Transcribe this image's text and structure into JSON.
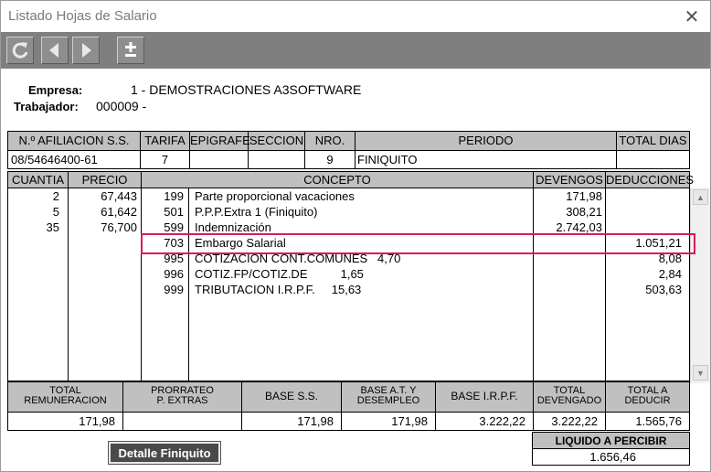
{
  "window": {
    "title": "Listado Hojas de Salario",
    "close_glyph": "✕"
  },
  "toolbar": {
    "buttons": [
      {
        "name": "refresh-icon"
      },
      {
        "name": "prev-icon"
      },
      {
        "name": "next-icon"
      },
      {
        "name": "plus-minus-icon"
      }
    ]
  },
  "header": {
    "empresa_label": "Empresa:",
    "empresa_value": "1 - DEMOSTRACIONES A3SOFTWARE",
    "trabajador_label": "Trabajador:",
    "trabajador_value": "000009 -"
  },
  "info_table": {
    "headers": [
      "N.º AFILIACION S.S.",
      "TARIFA",
      "EPIGRAFE",
      "SECCION",
      "NRO.",
      "PERIODO",
      "TOTAL DIAS"
    ],
    "values": [
      "08/54646400-61",
      "7",
      "",
      "",
      "9",
      "FINIQUITO",
      ""
    ]
  },
  "concept_table": {
    "headers": [
      "CUANTIA",
      "PRECIO",
      "CONCEPTO",
      "DEVENGOS",
      "DEDUCCIONES"
    ],
    "rows": [
      {
        "cuantia": "2",
        "precio": "67,443",
        "code": "199",
        "concepto": "Parte proporcional vacaciones",
        "devengos": "171,98",
        "deducciones": ""
      },
      {
        "cuantia": "5",
        "precio": "61,642",
        "code": "501",
        "concepto": "P.P.P.Extra 1 (Finiquito)",
        "devengos": "308,21",
        "deducciones": ""
      },
      {
        "cuantia": "35",
        "precio": "76,700",
        "code": "599",
        "concepto": "Indemnización",
        "devengos": "2.742,03",
        "deducciones": ""
      },
      {
        "cuantia": "",
        "precio": "",
        "code": "703",
        "concepto": "Embargo Salarial",
        "devengos": "",
        "deducciones": "1.051,21"
      },
      {
        "cuantia": "",
        "precio": "",
        "code": "995",
        "concepto": "COTIZACION CONT.COMUNES   4,70",
        "devengos": "",
        "deducciones": "8,08"
      },
      {
        "cuantia": "",
        "precio": "",
        "code": "996",
        "concepto": "COTIZ.FP/COTIZ.DE          1,65",
        "devengos": "",
        "deducciones": "2,84"
      },
      {
        "cuantia": "",
        "precio": "",
        "code": "999",
        "concepto": "TRIBUTACION I.R.P.F.     15,63",
        "devengos": "",
        "deducciones": "503,63"
      }
    ]
  },
  "totals": {
    "headers": [
      "TOTAL\nREMUNERACION",
      "PRORRATEO\nP. EXTRAS",
      "BASE S.S.",
      "BASE A.T. Y\nDESEMPLEO",
      "BASE I.R.P.F.",
      "TOTAL\nDEVENGADO",
      "TOTAL A\nDEDUCIR"
    ],
    "values": [
      "171,98",
      "",
      "171,98",
      "171,98",
      "3.222,22",
      "3.222,22",
      "1.565,76"
    ]
  },
  "liquido": {
    "label": "LIQUIDO A PERCIBIR",
    "value": "1.656,46"
  },
  "detalle_button": "Detalle Finiquito",
  "colors": {
    "highlight": "#d61c5a",
    "toolbar": "#7f7f7f",
    "header_gray": "#c0c0c0"
  }
}
